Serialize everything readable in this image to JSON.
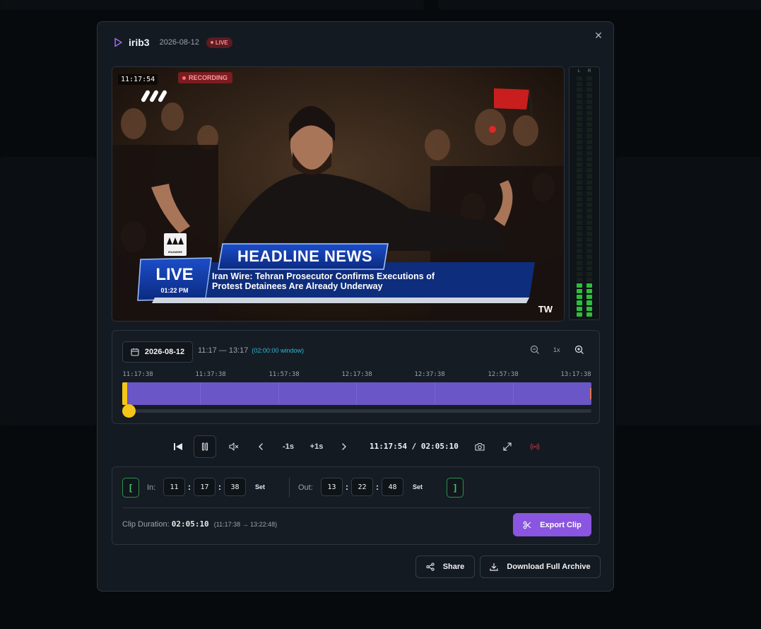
{
  "header": {
    "channel": "irib3",
    "date": "2026-08-12",
    "live_badge": "LIVE"
  },
  "video": {
    "timestamp": "11:17:54",
    "recording_label": "RECORDING",
    "lower_third": {
      "headline": "HEADLINE NEWS",
      "live_text": "LIVE",
      "live_time": "01:22 PM",
      "ticker_line1": "Iran Wire: Tehran Prosecutor Confirms Executions of",
      "ticker_line2": "Protest Detainees Are Already Underway",
      "logo_text": "IRANWIRE",
      "watermark": "TW"
    }
  },
  "audio_meter": {
    "left_label": "L",
    "right_label": "R",
    "level_left": 0.14,
    "level_right": 0.14,
    "colors": {
      "active": "#2ebd3a",
      "inactive": "#17201c"
    }
  },
  "timeline": {
    "date": "2026-08-12",
    "range": "11:17 — 13:17",
    "window": "(02:00:00 window)",
    "zoom_level": "1x",
    "ticks": [
      "11:17:38",
      "11:37:38",
      "11:57:38",
      "12:17:38",
      "12:37:38",
      "12:57:38",
      "13:17:38"
    ],
    "playhead_fraction": 0.015,
    "colors": {
      "track": "#6a56c6",
      "in_marker": "#f5c518",
      "out_marker": "#e0744a"
    }
  },
  "controls": {
    "minus_1s": "-1s",
    "plus_1s": "+1s",
    "current_time": "11:17:54",
    "separator": "/",
    "total_time": "02:05:10"
  },
  "clip": {
    "in_label": "In:",
    "in_h": "11",
    "in_m": "17",
    "in_s": "38",
    "out_label": "Out:",
    "out_h": "13",
    "out_m": "22",
    "out_s": "48",
    "set_label": "Set",
    "open_bracket": "[",
    "close_bracket": "]",
    "duration_label": "Clip Duration:",
    "duration_value": "02:05:10",
    "duration_range": "(11:17:38 → 13:22:48)",
    "export_label": "Export Clip"
  },
  "footer": {
    "share_label": "Share",
    "download_label": "Download Full Archive"
  },
  "colors": {
    "accent": "#8a55e0",
    "live_badge": "#5b1c22",
    "recording": "#7a1c20",
    "bracket_green": "#3fcf6a"
  }
}
